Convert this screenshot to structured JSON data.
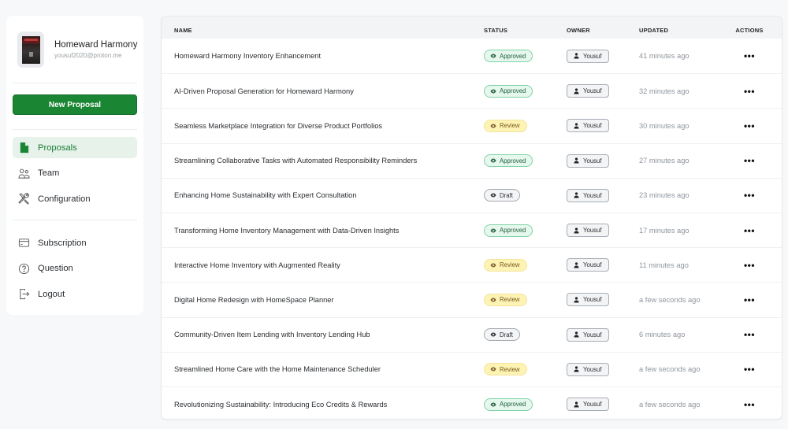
{
  "sidebar": {
    "profile": {
      "name": "Homeward Harmony",
      "email": "yousuf2020@proton.me",
      "avatar_icon": "profile-image"
    },
    "new_proposal_label": "New Proposal",
    "primary_nav": [
      {
        "label": "Proposals",
        "icon": "document-icon",
        "active": true
      },
      {
        "label": "Team",
        "icon": "people-icon",
        "active": false
      },
      {
        "label": "Configuration",
        "icon": "tools-icon",
        "active": false
      }
    ],
    "secondary_nav": [
      {
        "label": "Subscription",
        "icon": "credit-card-icon"
      },
      {
        "label": "Question",
        "icon": "question-circle-icon"
      },
      {
        "label": "Logout",
        "icon": "logout-icon"
      }
    ]
  },
  "table": {
    "columns": {
      "name": "NAME",
      "status": "STATUS",
      "owner": "OWNER",
      "updated": "UPDATED",
      "actions": "ACTIONS"
    },
    "rows": [
      {
        "name": "Homeward Harmony Inventory Enhancement",
        "status": "Approved",
        "status_type": "approved",
        "owner": "Yousuf",
        "updated": "41 minutes ago",
        "actions": "•••"
      },
      {
        "name": "AI-Driven Proposal Generation for Homeward Harmony",
        "status": "Approved",
        "status_type": "approved",
        "owner": "Yousuf",
        "updated": "32 minutes ago",
        "actions": "•••"
      },
      {
        "name": "Seamless Marketplace Integration for Diverse Product Portfolios",
        "status": "Review",
        "status_type": "review",
        "owner": "Yousuf",
        "updated": "30 minutes ago",
        "actions": "•••"
      },
      {
        "name": "Streamlining Collaborative Tasks with Automated Responsibility Reminders",
        "status": "Approved",
        "status_type": "approved",
        "owner": "Yousuf",
        "updated": "27 minutes ago",
        "actions": "•••"
      },
      {
        "name": "Enhancing Home Sustainability with Expert Consultation",
        "status": "Draft",
        "status_type": "draft",
        "owner": "Yousuf",
        "updated": "23 minutes ago",
        "actions": "•••"
      },
      {
        "name": "Transforming Home Inventory Management with Data-Driven Insights",
        "status": "Approved",
        "status_type": "approved",
        "owner": "Yousuf",
        "updated": "17 minutes ago",
        "actions": "•••"
      },
      {
        "name": "Interactive Home Inventory with Augmented Reality",
        "status": "Review",
        "status_type": "review",
        "owner": "Yousuf",
        "updated": "11 minutes ago",
        "actions": "•••"
      },
      {
        "name": "Digital Home Redesign with HomeSpace Planner",
        "status": "Review",
        "status_type": "review",
        "owner": "Yousuf",
        "updated": "a few seconds ago",
        "actions": "•••"
      },
      {
        "name": "Community-Driven Item Lending with Inventory Lending Hub",
        "status": "Draft",
        "status_type": "draft",
        "owner": "Yousuf",
        "updated": "6 minutes ago",
        "actions": "•••"
      },
      {
        "name": "Streamlined Home Care with the Home Maintenance Scheduler",
        "status": "Review",
        "status_type": "review",
        "owner": "Yousuf",
        "updated": "a few seconds ago",
        "actions": "•••"
      },
      {
        "name": "Revolutionizing Sustainability: Introducing Eco Credits & Rewards",
        "status": "Approved",
        "status_type": "approved",
        "owner": "Yousuf",
        "updated": "a few seconds ago",
        "actions": "•••"
      }
    ]
  },
  "colors": {
    "brand_green": "#1a8533",
    "active_nav_bg": "#e6f2ea",
    "approved_bg": "#e6f7ee",
    "review_bg": "#fdf3b4",
    "draft_bg": "#f3f4f6"
  }
}
